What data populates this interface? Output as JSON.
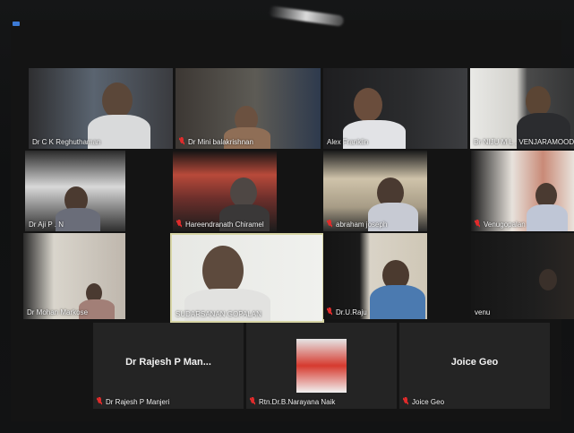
{
  "participants": {
    "row1": [
      "Dr C K Reghuthaman",
      "Dr Mini balakrishnan",
      "Alex Franklin",
      "Dr NIJU M L , VENJARAMOOD"
    ],
    "row2": [
      "Dr Aji P . N",
      "Hareendranath Chiramel",
      "abraham joseph",
      "Venugopalan"
    ],
    "row3": [
      "Dr Mohan Markose",
      "SUDARSANAN GOPALAN",
      "Dr.U.Raju",
      "venu"
    ],
    "row4": [
      "Dr Rajesh P Manjeri",
      "Rtn.Dr.B.Narayana Naik",
      "Joice Geo"
    ]
  },
  "text_tiles": {
    "rajesh_display": "Dr Rajesh P Man...",
    "joice_display": "Joice Geo"
  },
  "colors": {
    "muted_mic": "#e02b2b",
    "active_speaker_border": "#d8d6a6"
  }
}
